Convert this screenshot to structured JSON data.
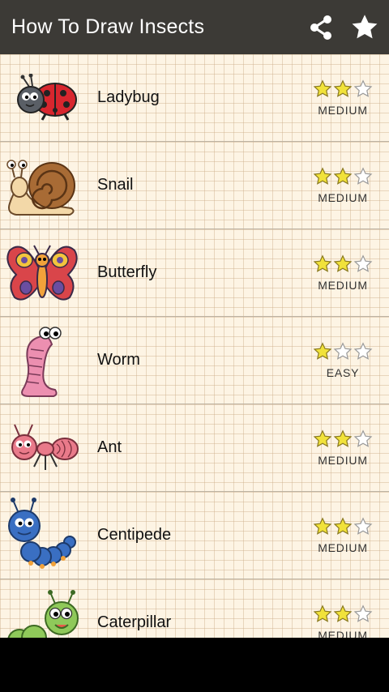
{
  "app_bar": {
    "title": "How To Draw Insects",
    "share_icon": "share-icon",
    "favorite_icon": "star-icon"
  },
  "colors": {
    "app_bar_bg": "#3c3a36",
    "paper_bg": "#fdf4e4",
    "star_fill": "#f1e23a",
    "star_empty": "#ffffff"
  },
  "insects": [
    {
      "name": "Ladybug",
      "difficulty": "MEDIUM",
      "stars": 2,
      "max_stars": 3,
      "icon": "ladybug-icon"
    },
    {
      "name": "Snail",
      "difficulty": "MEDIUM",
      "stars": 2,
      "max_stars": 3,
      "icon": "snail-icon"
    },
    {
      "name": "Butterfly",
      "difficulty": "MEDIUM",
      "stars": 2,
      "max_stars": 3,
      "icon": "butterfly-icon"
    },
    {
      "name": "Worm",
      "difficulty": "EASY",
      "stars": 1,
      "max_stars": 3,
      "icon": "worm-icon"
    },
    {
      "name": "Ant",
      "difficulty": "MEDIUM",
      "stars": 2,
      "max_stars": 3,
      "icon": "ant-icon"
    },
    {
      "name": "Centipede",
      "difficulty": "MEDIUM",
      "stars": 2,
      "max_stars": 3,
      "icon": "centipede-icon"
    },
    {
      "name": "Caterpillar",
      "difficulty": "MEDIUM",
      "stars": 2,
      "max_stars": 3,
      "icon": "caterpillar-icon"
    }
  ]
}
